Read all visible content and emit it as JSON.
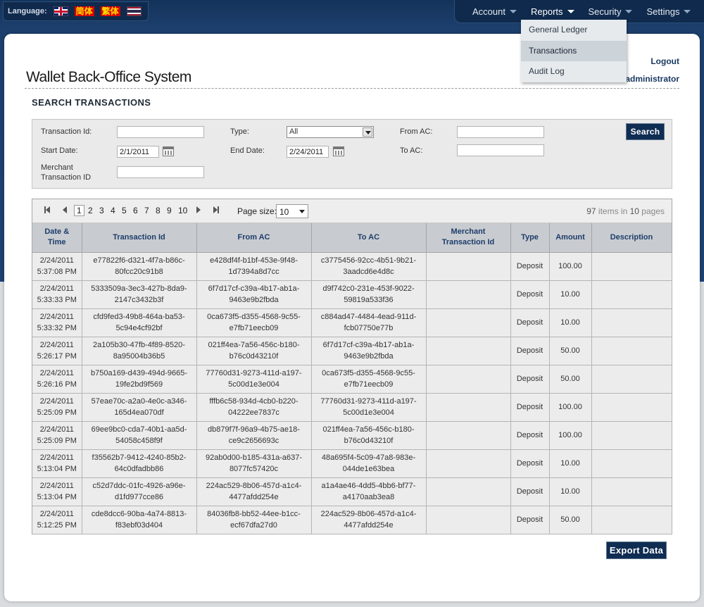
{
  "language": {
    "label": "Language:",
    "simplified_chinese": "简体",
    "traditional_chinese": "繁体"
  },
  "nav": {
    "items": [
      {
        "label": "Account"
      },
      {
        "label": "Reports"
      },
      {
        "label": "Security"
      },
      {
        "label": "Settings"
      }
    ],
    "reports_menu": [
      "General Ledger",
      "Transactions",
      "Audit Log"
    ]
  },
  "header": {
    "app_title": "Wallet Back-Office System",
    "logout": "Logout",
    "username": "administrator"
  },
  "page_title": "SEARCH TRANSACTIONS",
  "search": {
    "transaction_id_label": "Transaction Id:",
    "type_label": "Type:",
    "type_value": "All",
    "from_ac_label": "From AC:",
    "start_date_label": "Start Date:",
    "start_date_value": "2/1/2011",
    "end_date_label": "End Date:",
    "end_date_value": "2/24/2011",
    "to_ac_label": "To AC:",
    "merchant_label_1": "Merchant",
    "merchant_label_2": "Transaction ID",
    "search_button": "Search"
  },
  "pager": {
    "pages": [
      "1",
      "2",
      "3",
      "4",
      "5",
      "6",
      "7",
      "8",
      "9",
      "10"
    ],
    "current_page": "1",
    "page_size_label": "Page size:",
    "page_size": "10",
    "total_items": "97",
    "items_in_text": "items in",
    "total_pages": "10",
    "pages_text": "pages"
  },
  "table": {
    "columns": [
      [
        "Date &",
        "Time"
      ],
      [
        "Transaction Id",
        ""
      ],
      [
        "From AC",
        ""
      ],
      [
        "To AC",
        ""
      ],
      [
        "Merchant",
        "Transaction Id"
      ],
      [
        "Type",
        ""
      ],
      [
        "Amount",
        ""
      ],
      [
        "Description",
        ""
      ]
    ],
    "rows": [
      {
        "date": "2/24/2011",
        "time": "5:37:08 PM",
        "txn1": "e77822f6-d321-4f7a-b86c-",
        "txn2": "80fcc20c91b8",
        "from1": "e428df4f-b1bf-453e-9f48-",
        "from2": "1d7394a8d7cc",
        "to1": "c3775456-92cc-4b51-9b21-",
        "to2": "3aadcd6e4d8c",
        "merchant": "",
        "type": "Deposit",
        "amount": "100.00",
        "description": ""
      },
      {
        "date": "2/24/2011",
        "time": "5:33:33 PM",
        "txn1": "5333509a-3ec3-427b-8da9-",
        "txn2": "2147c3432b3f",
        "from1": "6f7d17cf-c39a-4b17-ab1a-",
        "from2": "9463e9b2fbda",
        "to1": "d9f742c0-231e-453f-9022-",
        "to2": "59819a533f36",
        "merchant": "",
        "type": "Deposit",
        "amount": "10.00",
        "description": ""
      },
      {
        "date": "2/24/2011",
        "time": "5:33:32 PM",
        "txn1": "cfd9fed3-49b8-464a-ba53-",
        "txn2": "5c94e4cf92bf",
        "from1": "0ca673f5-d355-4568-9c55-",
        "from2": "e7fb71eecb09",
        "to1": "c884ad47-4484-4ead-911d-",
        "to2": "fcb07750e77b",
        "merchant": "",
        "type": "Deposit",
        "amount": "10.00",
        "description": ""
      },
      {
        "date": "2/24/2011",
        "time": "5:26:17 PM",
        "txn1": "2a105b30-47fb-4f89-8520-",
        "txn2": "8a95004b36b5",
        "from1": "021ff4ea-7a56-456c-b180-",
        "from2": "b76c0d43210f",
        "to1": "6f7d17cf-c39a-4b17-ab1a-",
        "to2": "9463e9b2fbda",
        "merchant": "",
        "type": "Deposit",
        "amount": "50.00",
        "description": ""
      },
      {
        "date": "2/24/2011",
        "time": "5:26:16 PM",
        "txn1": "b750a169-d439-494d-9665-",
        "txn2": "19fe2bd9f569",
        "from1": "77760d31-9273-411d-a197-",
        "from2": "5c00d1e3e004",
        "to1": "0ca673f5-d355-4568-9c55-",
        "to2": "e7fb71eecb09",
        "merchant": "",
        "type": "Deposit",
        "amount": "50.00",
        "description": ""
      },
      {
        "date": "2/24/2011",
        "time": "5:25:09 PM",
        "txn1": "57eae70c-a2a0-4e0c-a346-",
        "txn2": "165d4ea070df",
        "from1": "fffb6c58-934d-4cb0-b220-",
        "from2": "04222ee7837c",
        "to1": "77760d31-9273-411d-a197-",
        "to2": "5c00d1e3e004",
        "merchant": "",
        "type": "Deposit",
        "amount": "100.00",
        "description": ""
      },
      {
        "date": "2/24/2011",
        "time": "5:25:09 PM",
        "txn1": "69ee9bc0-cda7-40b1-aa5d-",
        "txn2": "54058c458f9f",
        "from1": "db879f7f-96a9-4b75-ae18-",
        "from2": "ce9c2656693c",
        "to1": "021ff4ea-7a56-456c-b180-",
        "to2": "b76c0d43210f",
        "merchant": "",
        "type": "Deposit",
        "amount": "100.00",
        "description": ""
      },
      {
        "date": "2/24/2011",
        "time": "5:13:04 PM",
        "txn1": "f35562b7-9412-4240-85b2-",
        "txn2": "64c0dfadbb86",
        "from1": "92ab0d00-b185-431a-a637-",
        "from2": "8077fc57420c",
        "to1": "48a695f4-5c09-47a8-983e-",
        "to2": "044de1e63bea",
        "merchant": "",
        "type": "Deposit",
        "amount": "10.00",
        "description": ""
      },
      {
        "date": "2/24/2011",
        "time": "5:13:04 PM",
        "txn1": "c52d7ddc-01fc-4926-a96e-",
        "txn2": "d1fd977cce86",
        "from1": "224ac529-8b06-457d-a1c4-",
        "from2": "4477afdd254e",
        "to1": "a1a4ae46-4dd5-4bb6-bf77-",
        "to2": "a4170aab3ea8",
        "merchant": "",
        "type": "Deposit",
        "amount": "10.00",
        "description": ""
      },
      {
        "date": "2/24/2011",
        "time": "5:12:25 PM",
        "txn1": "cde8dcc6-90ba-4a74-8813-",
        "txn2": "f83ebf03d404",
        "from1": "84036fb8-bb52-44ee-b1cc-",
        "from2": "ecf67dfa27d0",
        "to1": "224ac529-8b06-457d-a1c4-",
        "to2": "4477afdd254e",
        "merchant": "",
        "type": "Deposit",
        "amount": "50.00",
        "description": ""
      }
    ]
  },
  "export_button": "Export Data",
  "colors": {
    "nav_bg": "#0f2a4c",
    "header_text": "#1d3d6a",
    "button_bg": "#0f2c52"
  }
}
